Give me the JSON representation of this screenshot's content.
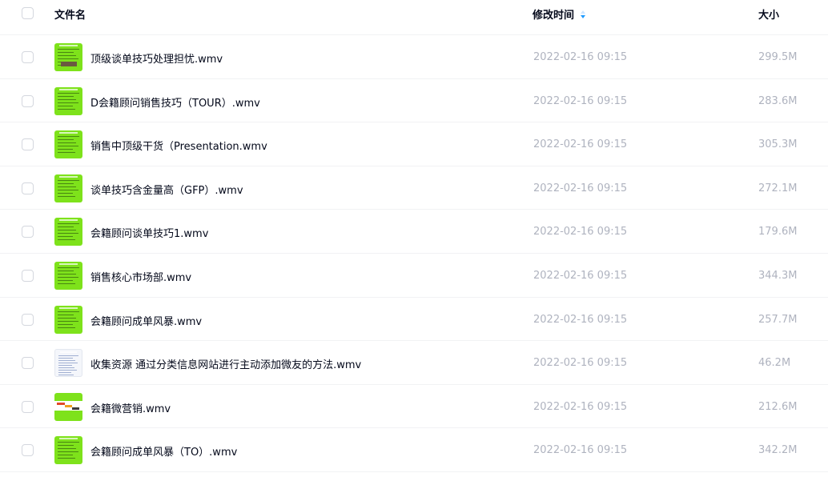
{
  "header": {
    "name_label": "文件名",
    "time_label": "修改时间",
    "size_label": "大小",
    "sort_icon": "sort-descending-icon"
  },
  "colors": {
    "thumb_green": "#7ee21b",
    "muted_text": "#afb3bf",
    "sort_accent": "#1e9bff"
  },
  "files": [
    {
      "name": "顶级谈单技巧处理担忧.wmv",
      "time": "2022-02-16 09:15",
      "size": "299.5M",
      "thumb": "green"
    },
    {
      "name": "D会籍顾问销售技巧（TOUR）.wmv",
      "time": "2022-02-16 09:15",
      "size": "283.6M",
      "thumb": "green"
    },
    {
      "name": "销售中顶级干货（Presentation.wmv",
      "time": "2022-02-16 09:15",
      "size": "305.3M",
      "thumb": "green"
    },
    {
      "name": "谈单技巧含金量高（GFP）.wmv",
      "time": "2022-02-16 09:15",
      "size": "272.1M",
      "thumb": "green"
    },
    {
      "name": "会籍顾问谈单技巧1.wmv",
      "time": "2022-02-16 09:15",
      "size": "179.6M",
      "thumb": "green"
    },
    {
      "name": "销售核心市场部.wmv",
      "time": "2022-02-16 09:15",
      "size": "344.3M",
      "thumb": "green"
    },
    {
      "name": "会籍顾问成单风暴.wmv",
      "time": "2022-02-16 09:15",
      "size": "257.7M",
      "thumb": "green"
    },
    {
      "name": "收集资源 通过分类信息网站进行主动添加微友的方法.wmv",
      "time": "2022-02-16 09:15",
      "size": "46.2M",
      "thumb": "doc"
    },
    {
      "name": "会籍微营销.wmv",
      "time": "2022-02-16 09:15",
      "size": "212.6M",
      "thumb": "banner"
    },
    {
      "name": "会籍顾问成单风暴（TO）.wmv",
      "time": "2022-02-16 09:15",
      "size": "342.2M",
      "thumb": "green"
    }
  ]
}
